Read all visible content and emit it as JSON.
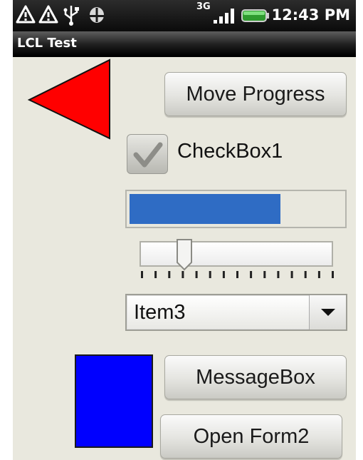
{
  "status_bar": {
    "time": "12:43 PM",
    "network_label": "3G",
    "icons": [
      "warning-icon",
      "warning-icon",
      "usb-icon",
      "android-debug-icon",
      "signal-icon",
      "battery-icon"
    ]
  },
  "window": {
    "title": "LCL Test"
  },
  "buttons": {
    "move_progress": "Move Progress",
    "message_box": "MessageBox",
    "open_form2": "Open Form2"
  },
  "checkbox": {
    "label": "CheckBox1",
    "checked": true
  },
  "progress": {
    "fraction": 0.71,
    "color": "#2f6cc4"
  },
  "slider": {
    "position_fraction": 0.23,
    "tick_count": 15
  },
  "combobox": {
    "selected": "Item3"
  },
  "shapes": {
    "triangle_color": "#ff0000",
    "rectangle_color": "#0000ff"
  }
}
